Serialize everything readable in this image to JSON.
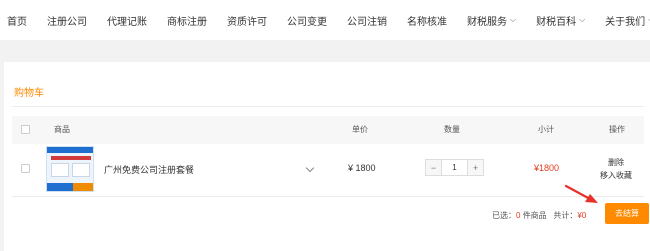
{
  "nav": {
    "items": [
      {
        "label": "首页",
        "dropdown": false
      },
      {
        "label": "注册公司",
        "dropdown": false
      },
      {
        "label": "代理记账",
        "dropdown": false
      },
      {
        "label": "商标注册",
        "dropdown": false
      },
      {
        "label": "资质许可",
        "dropdown": false
      },
      {
        "label": "公司变更",
        "dropdown": false
      },
      {
        "label": "公司注销",
        "dropdown": false
      },
      {
        "label": "名称核准",
        "dropdown": false
      },
      {
        "label": "财税服务",
        "dropdown": true
      },
      {
        "label": "财税百科",
        "dropdown": true
      },
      {
        "label": "关于我们",
        "dropdown": true
      }
    ]
  },
  "cart": {
    "title": "购物车",
    "columns": {
      "product": "商品",
      "price": "单价",
      "quantity": "数量",
      "subtotal": "小计",
      "actions": "操作"
    },
    "item": {
      "name": "广州免费公司注册套餐",
      "price": "¥ 1800",
      "quantity": "1",
      "subtotal": "¥1800",
      "delete_label": "删除",
      "favorite_label": "移入收藏"
    },
    "qty_minus": "−",
    "qty_plus": "+",
    "summary": {
      "selected_label": "已选：",
      "selected_count": "0",
      "selected_unit": "件商品",
      "total_label": "共计：",
      "total_value": "¥0"
    },
    "checkout_label": "去结算"
  },
  "colors": {
    "accent": "#ff8a00",
    "price_red": "#e23b1d",
    "arrow_red": "#e8312a"
  }
}
